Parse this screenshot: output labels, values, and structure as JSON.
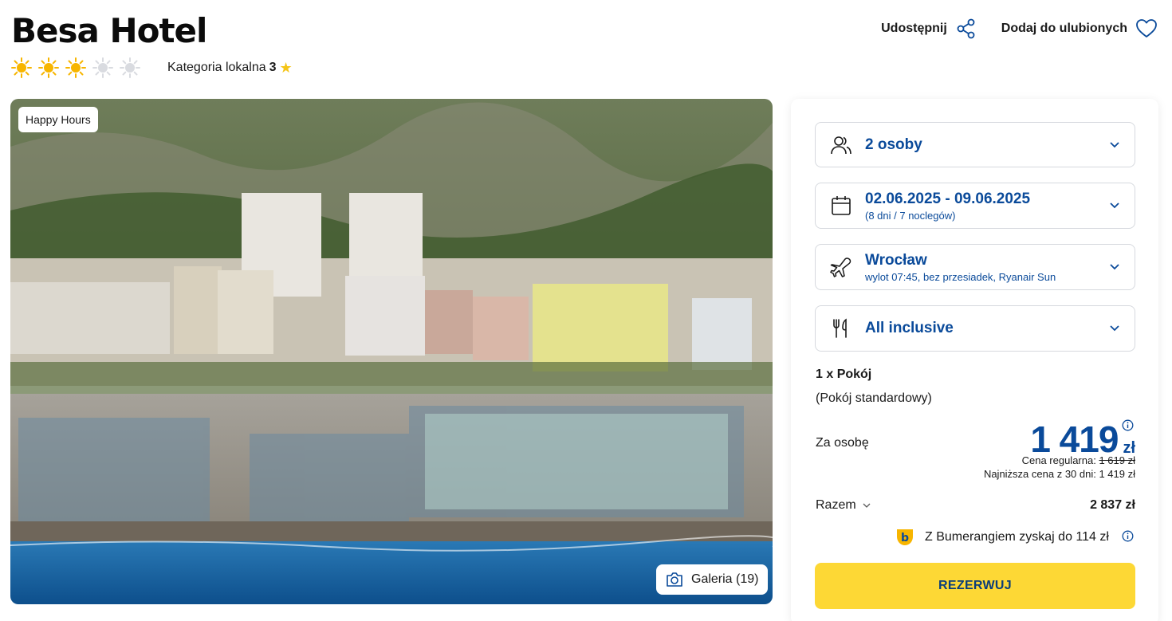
{
  "hotel": {
    "name": "Besa Hotel",
    "suns_filled": 3,
    "suns_total": 5,
    "local_category_label": "Kategoria lokalna",
    "local_category_value": "3"
  },
  "actions": {
    "share_label": "Udostępnij",
    "favorite_label": "Dodaj do ulubionych"
  },
  "photo": {
    "badge": "Happy Hours",
    "gallery_label": "Galeria (19)"
  },
  "booking": {
    "persons": "2 osoby",
    "dates": "02.06.2025 - 09.06.2025",
    "dates_sub": "(8 dni / 7 noclegów)",
    "departure_city": "Wrocław",
    "departure_sub": "wylot 07:45, bez przesiadek, Ryanair Sun",
    "board": "All inclusive",
    "room_count": "1 x Pokój",
    "room_type": "(Pokój standardowy)",
    "per_person_label": "Za osobę",
    "price": "1 419",
    "currency": "zł",
    "regular_price_label": "Cena regularna:",
    "regular_price": "1 619 zł",
    "lowest_price_text": "Najniższa cena z 30 dni: 1 419 zł",
    "total_label": "Razem",
    "total_value": "2 837 zł",
    "boomerang_text": "Z Bumerangiem zyskaj do 114 zł",
    "reserve_label": "REZERWUJ"
  },
  "colors": {
    "accent_blue": "#0a4a9a",
    "sun_yellow": "#f7b500",
    "reserve_yellow": "#fdd835"
  }
}
